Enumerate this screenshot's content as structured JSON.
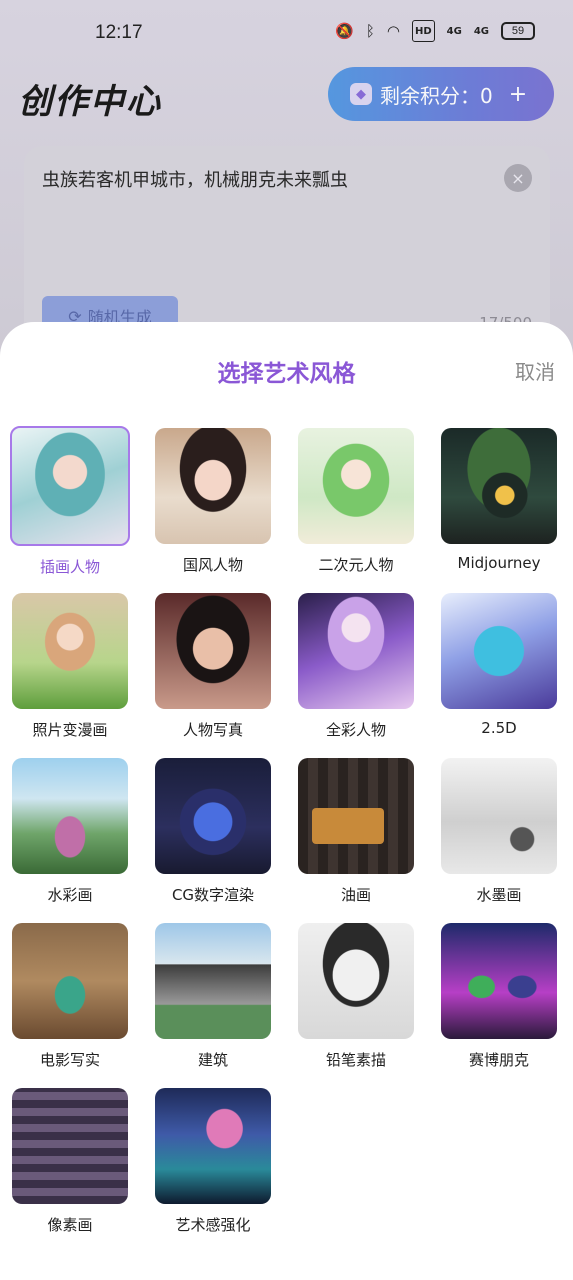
{
  "status_bar": {
    "time": "12:17",
    "battery": "59",
    "hd": "HD",
    "signal1": "4G",
    "signal2": "4G"
  },
  "header": {
    "title": "创作中心",
    "credits_label": "剩余积分：0",
    "credits_plus": "+"
  },
  "prompt": {
    "text": "虫族若客机甲城市，机械朋克未来瓢虫",
    "clear_icon": "×",
    "random_label": "随机生成",
    "counter": "17/500"
  },
  "sheet": {
    "title": "选择艺术风格",
    "cancel": "取消",
    "accent_color": "#8a57d6",
    "styles": [
      {
        "label": "插画人物",
        "selected": true
      },
      {
        "label": "国风人物"
      },
      {
        "label": "二次元人物"
      },
      {
        "label": "Midjourney"
      },
      {
        "label": "照片变漫画"
      },
      {
        "label": "人物写真"
      },
      {
        "label": "全彩人物"
      },
      {
        "label": "2.5D"
      },
      {
        "label": "水彩画"
      },
      {
        "label": "CG数字渲染"
      },
      {
        "label": "油画"
      },
      {
        "label": "水墨画"
      },
      {
        "label": "电影写实"
      },
      {
        "label": "建筑"
      },
      {
        "label": "铅笔素描"
      },
      {
        "label": "赛博朋克"
      },
      {
        "label": "像素画"
      },
      {
        "label": "艺术感强化"
      }
    ]
  }
}
